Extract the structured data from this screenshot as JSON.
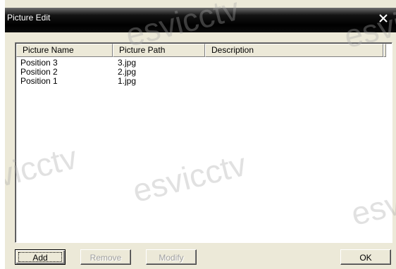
{
  "dialog": {
    "title": "Picture Edit",
    "close_icon": "close-icon"
  },
  "list": {
    "columns": [
      "Picture Name",
      "Picture Path",
      "Description"
    ],
    "rows": [
      {
        "name": "Position 3",
        "path": "3.jpg",
        "description": ""
      },
      {
        "name": "Position 2",
        "path": "2.jpg",
        "description": ""
      },
      {
        "name": "Position 1",
        "path": "1.jpg",
        "description": ""
      }
    ]
  },
  "buttons": {
    "add": "Add",
    "remove": "Remove",
    "modify": "Modify",
    "ok": "OK"
  },
  "watermark": "esvicctv"
}
